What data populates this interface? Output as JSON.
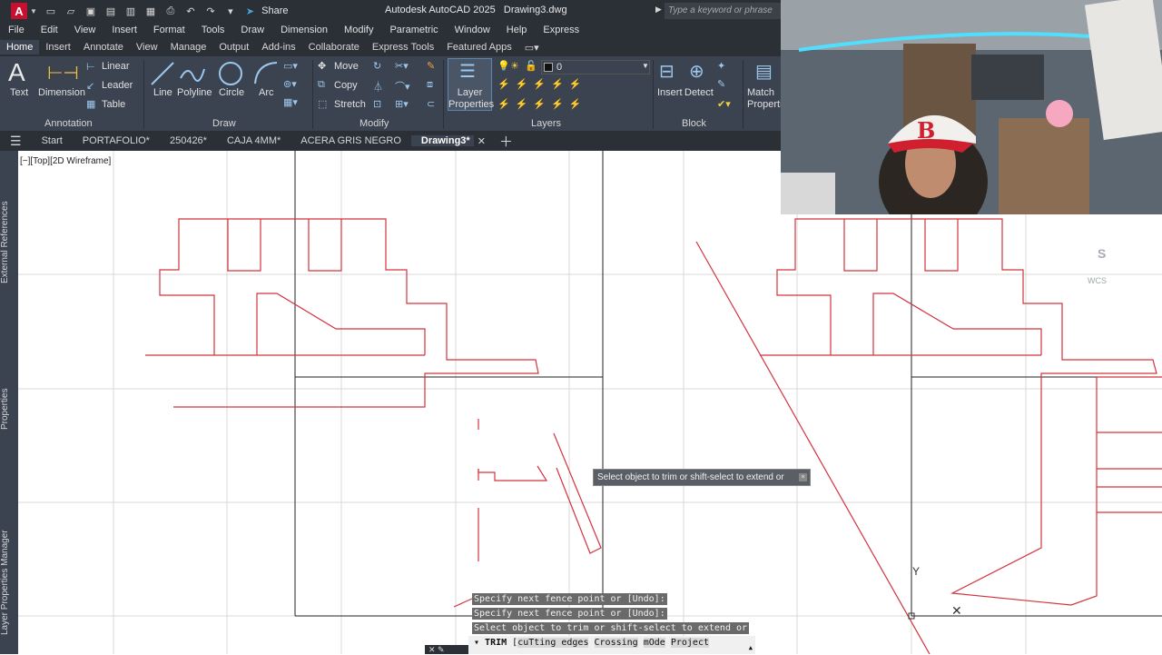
{
  "titlebar": {
    "app_title": "Autodesk AutoCAD 2025",
    "file_name": "Drawing3.dwg",
    "share_label": "Share",
    "search_placeholder": "Type a keyword or phrase",
    "logo_letter": "A"
  },
  "menu": [
    "File",
    "Edit",
    "View",
    "Insert",
    "Format",
    "Tools",
    "Draw",
    "Dimension",
    "Modify",
    "Parametric",
    "Window",
    "Help",
    "Express"
  ],
  "ribbon_tabs": [
    "Home",
    "Insert",
    "Annotate",
    "View",
    "Manage",
    "Output",
    "Add-ins",
    "Collaborate",
    "Express Tools",
    "Featured Apps"
  ],
  "ribbon": {
    "text": "Text",
    "dimension": "Dimension",
    "linear": "Linear",
    "leader": "Leader",
    "table": "Table",
    "line": "Line",
    "polyline": "Polyline",
    "circle": "Circle",
    "arc": "Arc",
    "move": "Move",
    "copy": "Copy",
    "stretch": "Stretch",
    "layer_properties": "Layer Properties",
    "layer_current": "0",
    "insert": "Insert",
    "detect": "Detect",
    "match_properties": "Match Properties",
    "panels": {
      "annotation": "Annotation",
      "draw": "Draw",
      "modify": "Modify",
      "layers": "Layers",
      "block": "Block"
    }
  },
  "file_tabs": [
    "Start",
    "PORTAFOLIO*",
    "250426*",
    "CAJA 4MM*",
    "ACERA GRIS NEGRO",
    "Drawing3*"
  ],
  "side_panels": [
    "External References",
    "Properties",
    "Layer Properties Manager"
  ],
  "viewport_label": "[−][Top][2D Wireframe]",
  "tooltip": "Select object to trim or shift-select to extend or",
  "command_history": [
    "Specify next fence point or [Undo]:",
    "Specify next fence point or [Undo]:",
    "Select object to trim or shift-select to extend or"
  ],
  "command_bar": {
    "command": "TRIM",
    "options_prefix": "[",
    "opt1": "cuTting edges",
    "opt2": "Crossing",
    "opt3": "mOde",
    "opt4": "Project"
  },
  "viewcube": {
    "south": "S",
    "wcs": "WCS"
  },
  "colors": {
    "drawing_line": "#d2343e",
    "ribbon_bg": "#3c4350",
    "titlebar_bg": "#2b2f36",
    "accent": "#4aa3df"
  }
}
